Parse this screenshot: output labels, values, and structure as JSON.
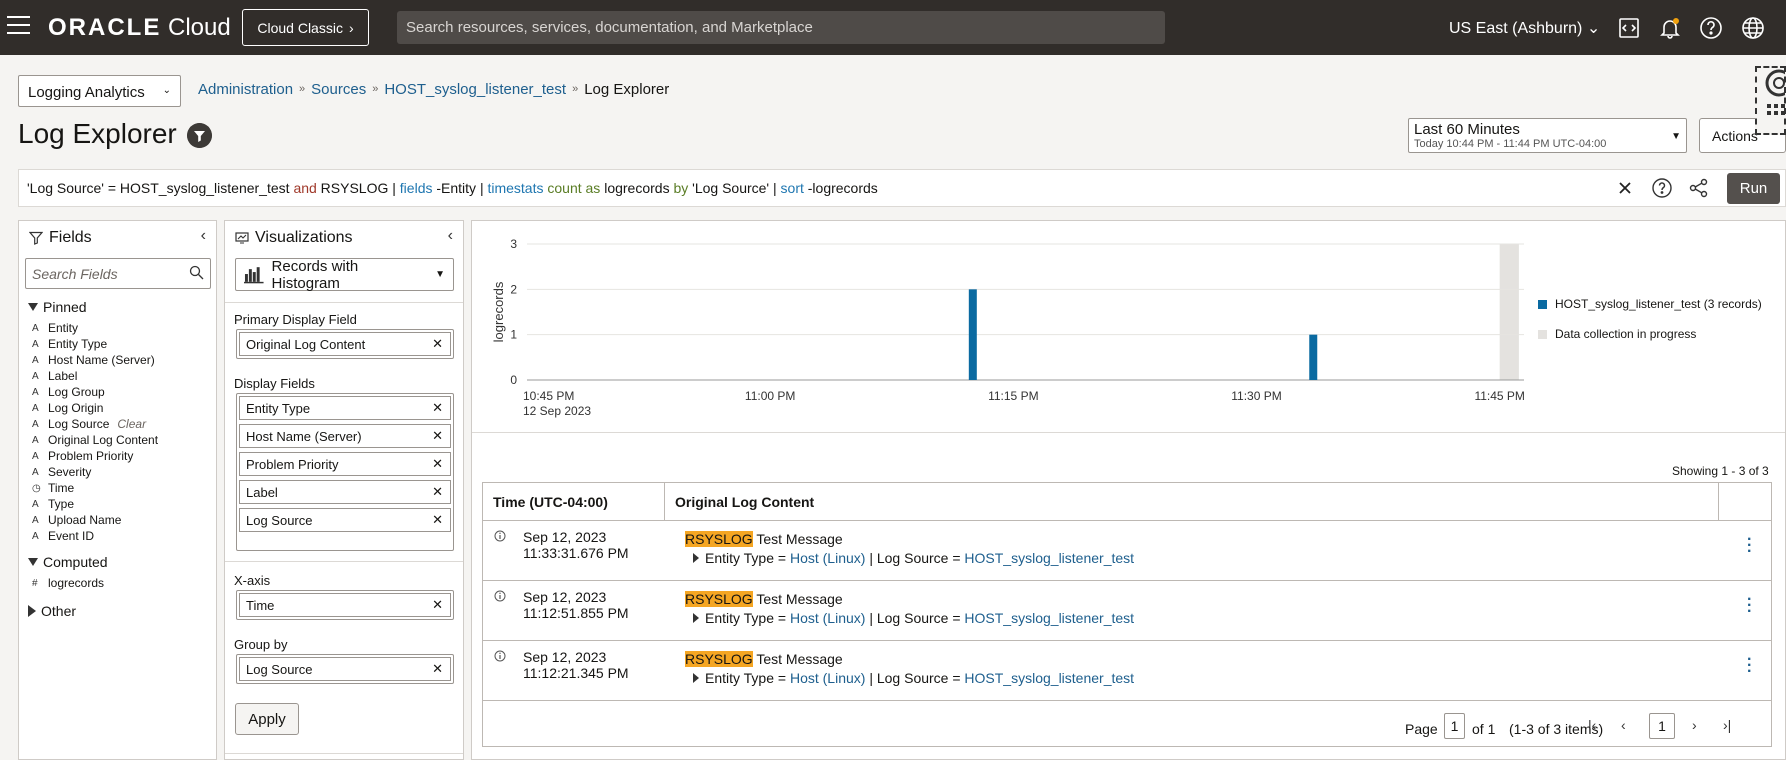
{
  "topbar": {
    "logo_bold": "ORACLE",
    "logo_light": " Cloud",
    "classic_label": "Cloud Classic",
    "search_placeholder": "Search resources, services, documentation, and Marketplace",
    "region": "US East (Ashburn)",
    "icons": [
      "code-console-icon",
      "bell-icon",
      "help-icon",
      "globe-icon"
    ]
  },
  "header": {
    "compartment": "Logging Analytics",
    "breadcrumb": [
      "Administration",
      "Sources",
      "HOST_syslog_listener_test",
      "Log Explorer"
    ],
    "title": "Log Explorer",
    "time_range": "Last 60 Minutes",
    "time_sub": "Today 10:44 PM - 11:44 PM UTC-04:00",
    "actions": "Actions"
  },
  "query": {
    "p1": "'Log Source' = HOST_syslog_listener_test ",
    "and": "and",
    "p2": " RSYSLOG | ",
    "fields": "fields",
    "p3": " -Entity | ",
    "timestats": "timestats",
    "sp1": " ",
    "count": "count",
    "sp2": " ",
    "as": "as",
    "p4": " logrecords ",
    "by": "by",
    "p5": " 'Log Source' | ",
    "sort": "sort",
    "p6": " -logrecords",
    "run": "Run"
  },
  "fields_panel": {
    "title": "Fields",
    "search_placeholder": "Search Fields",
    "pinned_label": "Pinned",
    "pinned": [
      {
        "type": "A",
        "name": "Entity"
      },
      {
        "type": "A",
        "name": "Entity Type"
      },
      {
        "type": "A",
        "name": "Host Name (Server)"
      },
      {
        "type": "A",
        "name": "Label"
      },
      {
        "type": "A",
        "name": "Log Group"
      },
      {
        "type": "A",
        "name": "Log Origin"
      },
      {
        "type": "A",
        "name": "Log Source"
      },
      {
        "type": "A",
        "name": "Original Log Content"
      },
      {
        "type": "A",
        "name": "Problem Priority"
      },
      {
        "type": "A",
        "name": "Severity"
      },
      {
        "type": "◷",
        "name": "Time"
      },
      {
        "type": "A",
        "name": "Type"
      },
      {
        "type": "A",
        "name": "Upload Name"
      },
      {
        "type": "A",
        "name": "Event ID"
      }
    ],
    "clear_label": "Clear",
    "computed_label": "Computed",
    "computed": [
      {
        "type": "#",
        "name": "logrecords"
      }
    ],
    "other_label": "Other"
  },
  "viz_panel": {
    "title": "Visualizations",
    "type": "Records with Histogram",
    "primary_label": "Primary Display Field",
    "primary": [
      "Original Log Content"
    ],
    "display_label": "Display Fields",
    "display": [
      "Entity Type",
      "Host Name (Server)",
      "Problem Priority",
      "Label",
      "Log Source"
    ],
    "xaxis_label": "X-axis",
    "xaxis": [
      "Time"
    ],
    "groupby_label": "Group by",
    "groupby": [
      "Log Source"
    ],
    "apply": "Apply"
  },
  "chart_data": {
    "type": "bar",
    "ylabel": "logrecords",
    "ylim": [
      0,
      3
    ],
    "yticks": [
      "0",
      "1",
      "2",
      "3"
    ],
    "x_tick_labels": [
      "10:45 PM",
      "11:00 PM",
      "11:15 PM",
      "11:30 PM",
      "11:45 PM"
    ],
    "x_tick_sublabel": "12 Sep 2023",
    "x_ticks_minutes": [
      0,
      15,
      30,
      45,
      60
    ],
    "xlim_minutes": [
      0,
      61.5
    ],
    "series": [
      {
        "name": "HOST_syslog_listener_test (3 records)",
        "color": "#0a6aa1",
        "points": [
          {
            "x_minute": 27.5,
            "value": 2
          },
          {
            "x_minute": 48.5,
            "value": 1
          }
        ]
      }
    ],
    "in_progress": {
      "name": "Data collection in progress",
      "color": "#e4e2df",
      "x_minute_start": 60,
      "x_minute_end": 61
    }
  },
  "results": {
    "showing": "Showing 1 - 3 of 3",
    "col_time": "Time (UTC-04:00)",
    "col_content": "Original Log Content",
    "rows": [
      {
        "date": "Sep 12, 2023",
        "time": "11:33:31.676 PM",
        "hl": "RSYSLOG",
        "msg": " Test Message",
        "et_label": "Entity Type = ",
        "et": "Host (Linux)",
        "ls_label": " | Log Source = ",
        "ls": "HOST_syslog_listener_test"
      },
      {
        "date": "Sep 12, 2023",
        "time": "11:12:51.855 PM",
        "hl": "RSYSLOG",
        "msg": " Test Message",
        "et_label": "Entity Type = ",
        "et": "Host (Linux)",
        "ls_label": " | Log Source = ",
        "ls": "HOST_syslog_listener_test"
      },
      {
        "date": "Sep 12, 2023",
        "time": "11:12:21.345 PM",
        "hl": "RSYSLOG",
        "msg": " Test Message",
        "et_label": "Entity Type = ",
        "et": "Host (Linux)",
        "ls_label": " | Log Source = ",
        "ls": "HOST_syslog_listener_test"
      }
    ],
    "pager": {
      "page_label": "Page",
      "page": "1",
      "of": "of 1",
      "items": "(1-3 of 3 items)",
      "current": "1"
    }
  }
}
